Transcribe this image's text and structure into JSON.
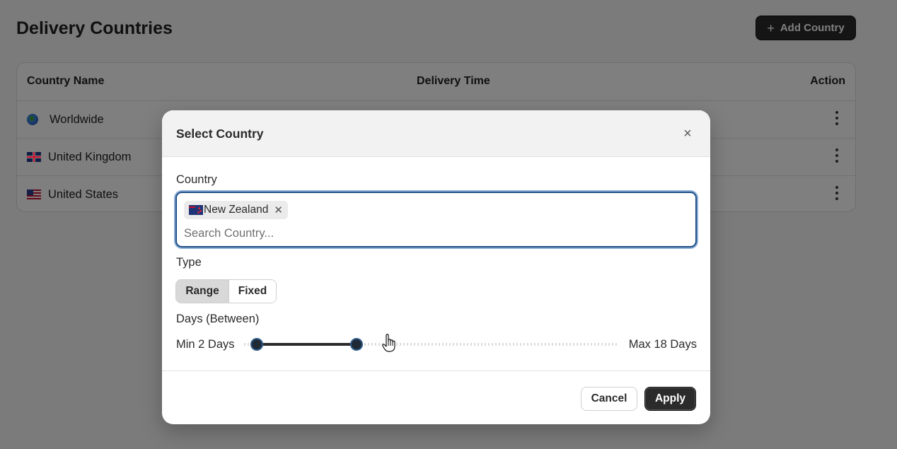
{
  "page": {
    "title": "Delivery Countries",
    "add_button_label": "Add Country"
  },
  "table": {
    "columns": [
      "Country Name",
      "Delivery Time",
      "Action"
    ],
    "rows": [
      {
        "flag_icon": "globe-icon",
        "name": "Worldwide"
      },
      {
        "flag_icon": "uk-flag-icon",
        "name": "United Kingdom"
      },
      {
        "flag_icon": "us-flag-icon",
        "name": "United States"
      }
    ]
  },
  "modal": {
    "title": "Select Country",
    "country_label": "Country",
    "selected_countries": [
      {
        "flag_icon": "nz-flag-icon",
        "name": "New Zealand"
      }
    ],
    "search_placeholder": "Search Country...",
    "type_label": "Type",
    "type_options": [
      "Range",
      "Fixed"
    ],
    "type_selected": "Range",
    "days_label": "Days (Between)",
    "range": {
      "min_label": "Min 2 Days",
      "max_label": "Max 18 Days",
      "min_value": 2,
      "max_value": 18,
      "scale_max": 60
    },
    "cancel_label": "Cancel",
    "apply_label": "Apply"
  },
  "colors": {
    "primary_button": "#2b2b2b",
    "focus_border": "#1f4f86",
    "overlay": "rgba(0,0,0,0.5)"
  }
}
